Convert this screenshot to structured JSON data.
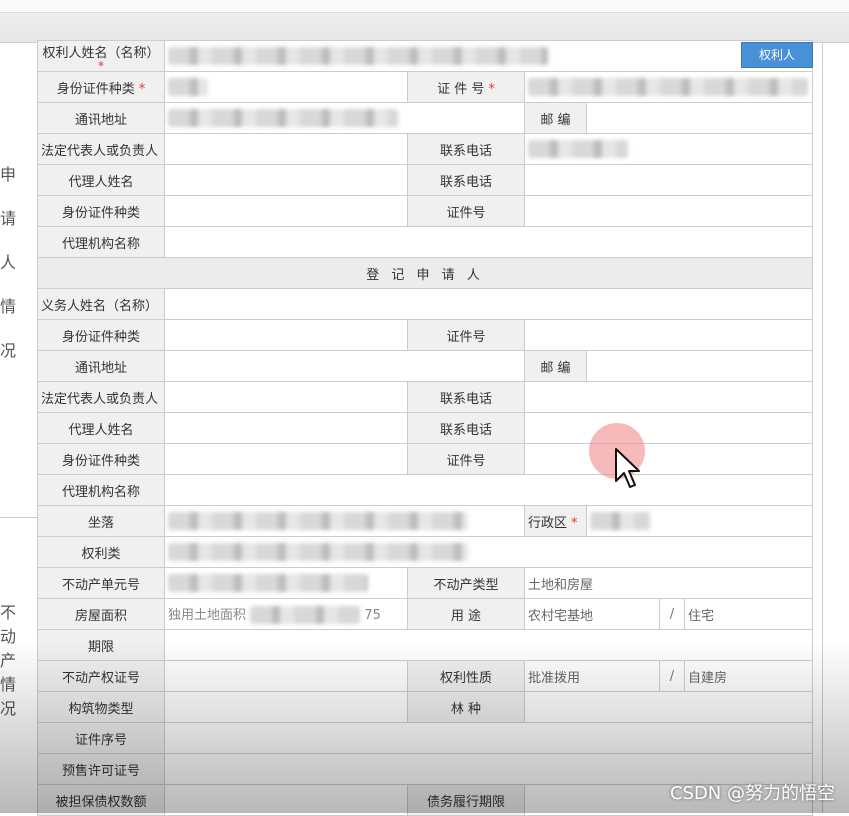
{
  "action_button": "权利人",
  "section_sidebar": {
    "applicant": [
      "申",
      "请",
      "人",
      "情",
      "况"
    ],
    "property": [
      "不",
      "动",
      "产",
      "情",
      "况"
    ]
  },
  "rows_top": {
    "rights_holder_name": "权利人姓名（名称）",
    "id_type": "身份证件种类",
    "id_number": "证 件 号",
    "address": "通讯地址",
    "postcode": "邮 编",
    "legal_rep": "法定代表人或负责人",
    "phone": "联系电话",
    "agent_name": "代理人姓名",
    "agent_phone": "联系电话",
    "agent_id_type": "身份证件种类",
    "agent_id_number": "证件号",
    "agency_name": "代理机构名称"
  },
  "section_title": "登 记 申 请 人",
  "rows_obligor": {
    "name": "义务人姓名（名称）",
    "id_type": "身份证件种类",
    "id_number": "证件号",
    "address": "通讯地址",
    "postcode": "邮 编",
    "legal_rep": "法定代表人或负责人",
    "phone": "联系电话",
    "agent_name": "代理人姓名",
    "agent_phone": "联系电话",
    "agent_id_type": "身份证件种类",
    "agent_id_number": "证件号",
    "agency_name": "代理机构名称"
  },
  "property": {
    "location": "坐落",
    "district": "行政区",
    "right_type": "权利类",
    "unit_no": "不动产单元号",
    "property_type_label": "不动产类型",
    "property_type_value": "土地和房屋",
    "house_area": "房屋面积",
    "house_area_value": "独用土地面积",
    "house_area_suffix": "75",
    "usage_label": "用 途",
    "usage_value1": "农村宅基地",
    "usage_value2": "住宅",
    "term": "期限",
    "cert_no": "不动产权证号",
    "right_nature_label": "权利性质",
    "right_nature_value1": "批准拨用",
    "right_nature_value2": "自建房",
    "structure_type": "构筑物类型",
    "forest_type": "林 种",
    "cert_seq": "证件序号",
    "presale_no": "预售许可证号",
    "secured_amount": "被担保债权数额",
    "debt_term": "债务履行期限"
  },
  "separator": "/",
  "watermark": "CSDN @努力的悟空"
}
